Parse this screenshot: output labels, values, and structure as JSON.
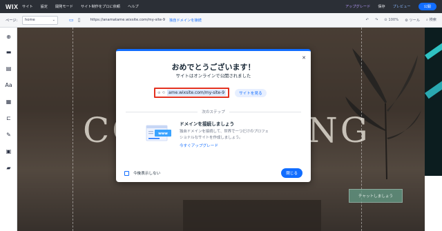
{
  "topbar": {
    "logo": "WIX",
    "menu": [
      "サイト",
      "設定",
      "開発モード",
      "サイト制作をプロに依頼",
      "ヘルプ"
    ],
    "upgrade_label": "アップグレード",
    "save_label": "保存",
    "preview_label": "プレビュー",
    "publish_label": "公開"
  },
  "secondbar": {
    "page_label": "ページ:",
    "page_value": "home",
    "url": "https://anamatame.wixsite.com/my-site-9",
    "connect_domain": "独自ドメインを接続",
    "zoom": "100%",
    "tools_label": "ツール",
    "search_label": "検索"
  },
  "canvas": {
    "heading_left": "CO",
    "heading_right": "NG",
    "chat_button": "チャットしましょう"
  },
  "modal": {
    "title": "おめでとうございます！",
    "subtitle": "サイトはオンラインで公開されました",
    "url_value": "ame.wixsite.com/my-site-9",
    "view_site_label": "サイトを見る",
    "next_step_label": "次のステップ",
    "domain_title": "ドメインを接続しましょう",
    "domain_desc_line1": "独自ドメインを接続して、世界で一つだけのプロフェ",
    "domain_desc_line2": "ショナルなサイトを作成しましょう。",
    "upgrade_link": "今すぐアップグレード",
    "illus_label": "www",
    "dont_show_label": "今後表示しない",
    "close_label": "閉じる"
  },
  "colors": {
    "accent": "#116dff",
    "highlight_border": "#e3301f",
    "topbar": "#2b2f36"
  }
}
